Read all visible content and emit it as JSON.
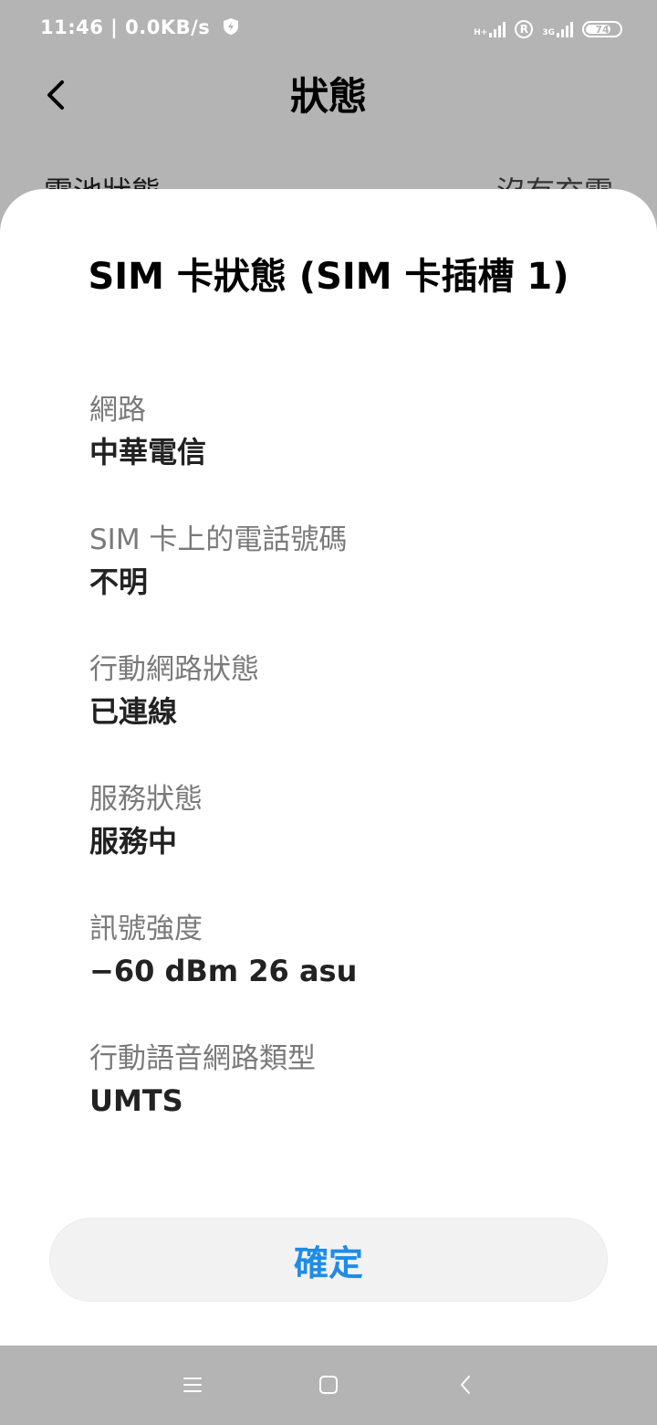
{
  "status_bar": {
    "time_speed": "11:46 | 0.0KB/s",
    "shield_icon": "shield-bolt-icon",
    "sim1_network_type": "H+",
    "roaming_indicator": "R",
    "sim2_network_type": "3G",
    "battery_level": "74",
    "battery_fraction": 0.74
  },
  "header": {
    "back_icon": "chevron-left-icon",
    "title": "狀態"
  },
  "background_row": {
    "label": "電池狀態",
    "value": "沒有充電"
  },
  "sheet": {
    "title": "SIM 卡狀態 (SIM 卡插槽 1)",
    "items": [
      {
        "label": "網路",
        "value": "中華電信"
      },
      {
        "label": "SIM 卡上的電話號碼",
        "value": "不明"
      },
      {
        "label": "行動網路狀態",
        "value": "已連線"
      },
      {
        "label": "服務狀態",
        "value": "服務中"
      },
      {
        "label": "訊號強度",
        "value": "−60 dBm 26 asu"
      },
      {
        "label": "行動語音網路類型",
        "value": "UMTS"
      }
    ],
    "confirm_label": "確定",
    "accent_color": "#1f8ce6"
  },
  "nav_bar": {
    "menu_icon": "menu-icon",
    "home_icon": "home-square-icon",
    "back_icon": "back-chevron-icon"
  }
}
